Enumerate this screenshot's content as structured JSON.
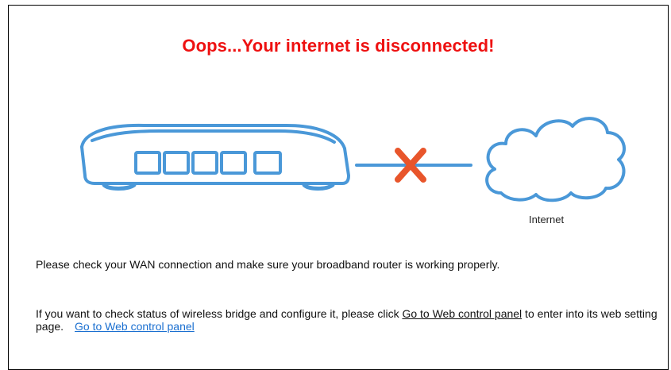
{
  "header": {
    "title": "Oops...Your internet is disconnected!"
  },
  "diagram": {
    "router_icon": "router-icon",
    "link_status_icon": "disconnected-x-icon",
    "cloud_icon": "cloud-icon",
    "internet_label": "Internet",
    "colors": {
      "line": "#4a98d8",
      "x_mark": "#e8552b",
      "title": "#ee1111",
      "link": "#1a6fd0"
    }
  },
  "messages": {
    "wan": "Please check your WAN connection and make sure your broadband router is working properly.",
    "bridge_before_link": "If you want to check status of wireless bridge and configure it, please click ",
    "inline_link": "Go to Web control panel",
    "bridge_after_link": " to enter into its web setting page.",
    "blue_link": "Go to Web control panel"
  }
}
